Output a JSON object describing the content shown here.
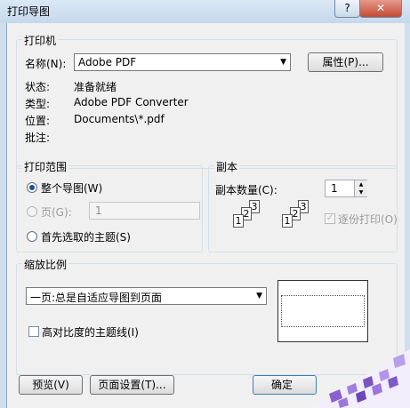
{
  "window": {
    "title": "打印导图",
    "help_label": "?",
    "close_label": "✕"
  },
  "printer": {
    "group_title": "打印机",
    "name_label": "名称(N):",
    "name_value": "Adobe PDF",
    "properties_label": "属性(P)...",
    "status_label": "状态:",
    "status_value": "准备就绪",
    "type_label": "类型:",
    "type_value": "Adobe PDF Converter",
    "location_label": "位置:",
    "location_value": "Documents\\*.pdf",
    "comment_label": "批注:"
  },
  "range": {
    "group_title": "打印范围",
    "whole_map_label": "整个导图(W)",
    "pages_label": "页(G):",
    "pages_value": "1",
    "first_topic_label": "首先选取的主题(S)"
  },
  "copies": {
    "group_title": "副本",
    "count_label": "副本数量(C):",
    "count_value": "1",
    "collate_label": "逐份打印(O)",
    "page_numbers_set1": [
      "1",
      "2",
      "3"
    ],
    "page_numbers_set2": [
      "1",
      "2",
      "3"
    ]
  },
  "scale": {
    "group_title": "缩放比例",
    "mode_value": "一页:总是自适应导图到页面",
    "high_contrast_label": "高对比度的主题线(I)"
  },
  "footer": {
    "preview_label": "预览(V)",
    "page_setup_label": "页面设置(T)...",
    "ok_label": "确定"
  },
  "colors": {
    "accent": "#1c4f95",
    "close_button": "#c34a33",
    "frame": "#cfdfee",
    "watermark": "#8a5fd0"
  }
}
